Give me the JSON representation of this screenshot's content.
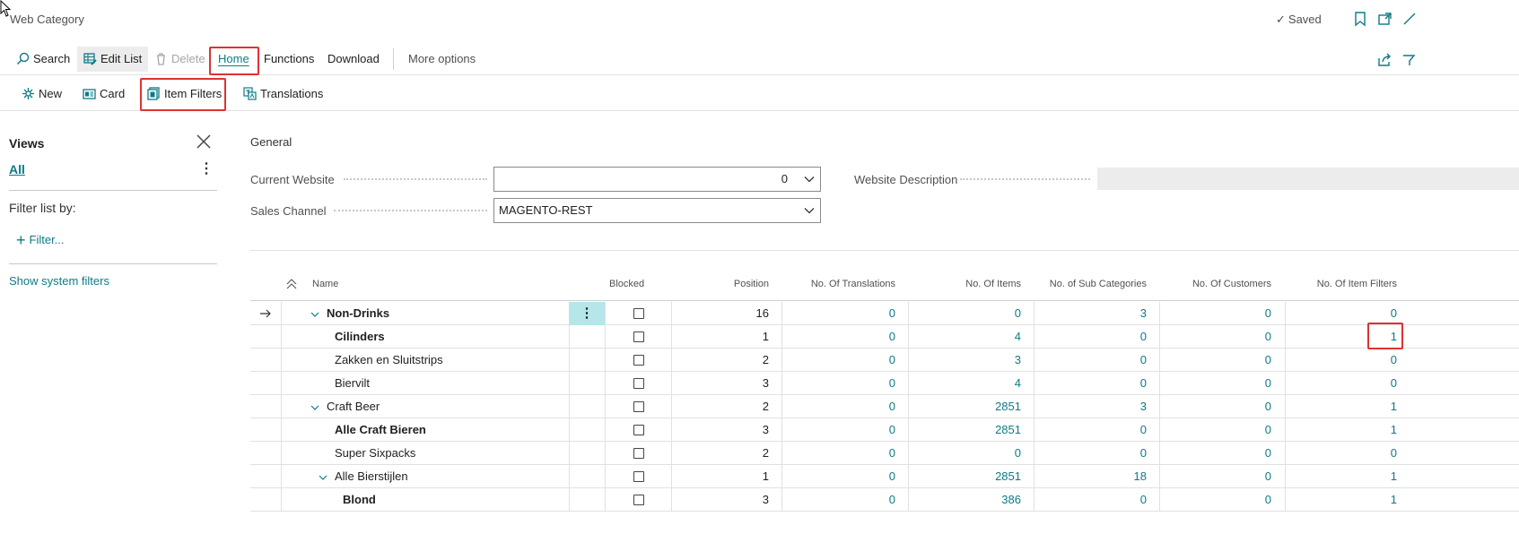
{
  "window": {
    "title": "Web Category",
    "saved_label": "Saved"
  },
  "actions": {
    "search": "Search",
    "edit_list": "Edit List",
    "delete": "Delete",
    "home": "Home",
    "functions": "Functions",
    "download": "Download",
    "more_options": "More options"
  },
  "home_actions": {
    "new": "New",
    "card": "Card",
    "item_filters": "Item Filters",
    "translations": "Translations"
  },
  "views": {
    "title": "Views",
    "all": "All",
    "filter_list_by": "Filter list by:",
    "add_filter": "Filter...",
    "show_system_filters": "Show system filters"
  },
  "general": {
    "title": "General",
    "current_website_label": "Current Website",
    "current_website_value": "0",
    "sales_channel_label": "Sales Channel",
    "sales_channel_value": "MAGENTO-REST",
    "website_description_label": "Website Description",
    "website_description_value": ""
  },
  "table": {
    "headers": {
      "name": "Name",
      "blocked": "Blocked",
      "position": "Position",
      "translations": "No. Of Translations",
      "items": "No. Of Items",
      "sub_categories": "No. of Sub Categories",
      "customers": "No. Of Customers",
      "item_filters": "No. Of Item Filters"
    },
    "rows": [
      {
        "name": "Non-Drinks",
        "bold": true,
        "expander": true,
        "indent": 0,
        "current": true,
        "position": "16",
        "translations": "0",
        "items": "0",
        "sub_categories": "3",
        "customers": "0",
        "item_filters": "0"
      },
      {
        "name": "Cilinders",
        "bold": true,
        "expander": false,
        "indent": 1,
        "current": false,
        "position": "1",
        "translations": "0",
        "items": "4",
        "sub_categories": "0",
        "customers": "0",
        "item_filters": "1"
      },
      {
        "name": "Zakken en Sluitstrips",
        "bold": false,
        "expander": false,
        "indent": 1,
        "current": false,
        "position": "2",
        "translations": "0",
        "items": "3",
        "sub_categories": "0",
        "customers": "0",
        "item_filters": "0"
      },
      {
        "name": "Biervilt",
        "bold": false,
        "expander": false,
        "indent": 1,
        "current": false,
        "position": "3",
        "translations": "0",
        "items": "4",
        "sub_categories": "0",
        "customers": "0",
        "item_filters": "0"
      },
      {
        "name": "Craft Beer",
        "bold": false,
        "expander": true,
        "indent": 0,
        "current": false,
        "position": "2",
        "translations": "0",
        "items": "2851",
        "sub_categories": "3",
        "customers": "0",
        "item_filters": "1"
      },
      {
        "name": "Alle Craft Bieren",
        "bold": true,
        "expander": false,
        "indent": 1,
        "current": false,
        "position": "3",
        "translations": "0",
        "items": "2851",
        "sub_categories": "0",
        "customers": "0",
        "item_filters": "1"
      },
      {
        "name": "Super Sixpacks",
        "bold": false,
        "expander": false,
        "indent": 1,
        "current": false,
        "position": "2",
        "translations": "0",
        "items": "0",
        "sub_categories": "0",
        "customers": "0",
        "item_filters": "0"
      },
      {
        "name": "Alle Bierstijlen",
        "bold": false,
        "expander": true,
        "indent": 1,
        "current": false,
        "position": "1",
        "translations": "0",
        "items": "2851",
        "sub_categories": "18",
        "customers": "0",
        "item_filters": "1"
      },
      {
        "name": "Blond",
        "bold": true,
        "expander": false,
        "indent": 2,
        "current": false,
        "position": "3",
        "translations": "0",
        "items": "386",
        "sub_categories": "0",
        "customers": "0",
        "item_filters": "1"
      }
    ]
  },
  "colors": {
    "accent": "#0d7b86",
    "highlight": "#e03131",
    "selected_cell": "#b4e6ea"
  }
}
